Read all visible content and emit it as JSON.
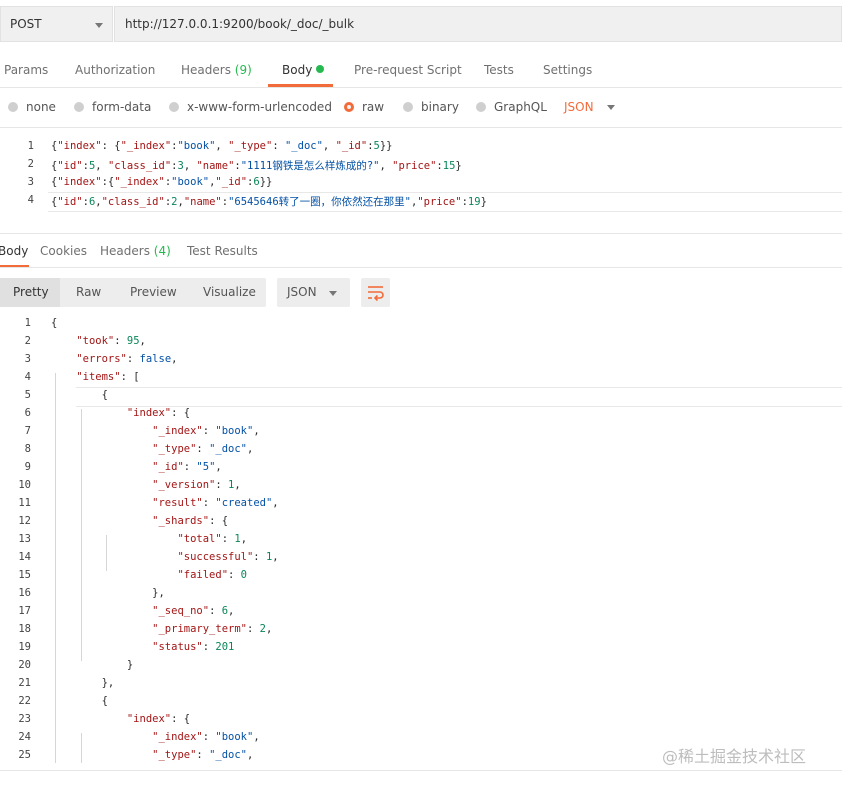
{
  "request": {
    "method": "POST",
    "url": "http://127.0.0.1:9200/book/_doc/_bulk",
    "tabs": [
      {
        "label": "Params"
      },
      {
        "label": "Authorization"
      },
      {
        "label": "Headers",
        "count": "(9)"
      },
      {
        "label": "Body"
      },
      {
        "label": "Pre-request Script"
      },
      {
        "label": "Tests"
      },
      {
        "label": "Settings"
      }
    ],
    "body_options": [
      "none",
      "form-data",
      "x-www-form-urlencoded",
      "raw",
      "binary",
      "GraphQL"
    ],
    "body_format": "JSON"
  },
  "request_body": [
    "{\"index\": {\"_index\":\"book\", \"_type\": \"_doc\", \"_id\":5}}",
    "{\"id\":5, \"class_id\":3, \"name\":\"1111钢铁是怎么样炼成的?\", \"price\":15}",
    "{\"index\":{\"_index\":\"book\",\"_id\":6}}",
    "{\"id\":6,\"class_id\":2,\"name\":\"6545646转了一圈，你依然还在那里\",\"price\":19}"
  ],
  "response": {
    "tabs": [
      {
        "label": "Body"
      },
      {
        "label": "Cookies"
      },
      {
        "label": "Headers",
        "count": "(4)"
      },
      {
        "label": "Test Results"
      }
    ],
    "view_modes": [
      "Pretty",
      "Raw",
      "Preview",
      "Visualize"
    ],
    "format": "JSON",
    "lines": [
      "{",
      "    \"took\": 95,",
      "    \"errors\": false,",
      "    \"items\": [",
      "        {",
      "            \"index\": {",
      "                \"_index\": \"book\",",
      "                \"_type\": \"_doc\",",
      "                \"_id\": \"5\",",
      "                \"_version\": 1,",
      "                \"result\": \"created\",",
      "                \"_shards\": {",
      "                    \"total\": 1,",
      "                    \"successful\": 1,",
      "                    \"failed\": 0",
      "                },",
      "                \"_seq_no\": 6,",
      "                \"_primary_term\": 2,",
      "                \"status\": 201",
      "            }",
      "        },",
      "        {",
      "            \"index\": {",
      "                \"_index\": \"book\",",
      "                \"_type\": \"_doc\","
    ]
  },
  "watermark": "@稀土掘金技术社区",
  "colors": {
    "accent": "#f26b3a",
    "ok": "#26b94f"
  }
}
